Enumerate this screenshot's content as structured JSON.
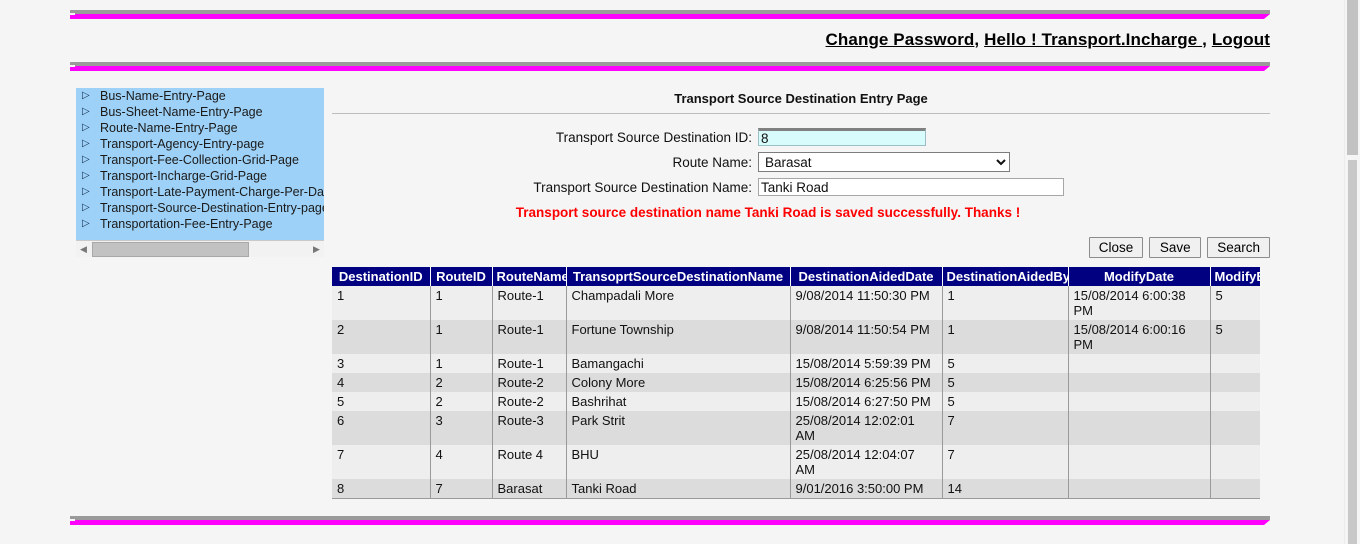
{
  "header": {
    "change_password": "Change Password",
    "separator1": ", ",
    "greeting": "Hello ! Transport.Incharge ",
    "separator2": ", ",
    "logout": "Logout"
  },
  "sidebar": {
    "items": [
      {
        "label": "Bus-Name-Entry-Page"
      },
      {
        "label": "Bus-Sheet-Name-Entry-Page"
      },
      {
        "label": "Route-Name-Entry-Page"
      },
      {
        "label": "Transport-Agency-Entry-page"
      },
      {
        "label": "Transport-Fee-Collection-Grid-Page"
      },
      {
        "label": "Transport-Incharge-Grid-Page"
      },
      {
        "label": "Transport-Late-Payment-Charge-Per-Day-Page"
      },
      {
        "label": "Transport-Source-Destination-Entry-page"
      },
      {
        "label": "Transportation-Fee-Entry-Page"
      }
    ],
    "scroll_left_arrow": "◀",
    "scroll_right_arrow": "▶"
  },
  "main": {
    "title": "Transport Source Destination Entry Page",
    "fields": {
      "id_label": "Transport Source Destination ID:",
      "id_value": "8",
      "route_label": "Route Name:",
      "route_value": "Barasat",
      "route_options": [
        "Barasat"
      ],
      "name_label": "Transport Source Destination Name:",
      "name_value": "Tanki Road",
      "name_placeholder": ""
    },
    "message": "Transport source destination name Tanki Road is saved successfully. Thanks !",
    "buttons": {
      "close": "Close",
      "save": "Save",
      "search": "Search"
    }
  },
  "grid": {
    "columns": [
      "DestinationID",
      "RouteID",
      "RouteName",
      "TransoprtSourceDestinationName",
      "DestinationAidedDate",
      "DestinationAidedBy",
      "ModifyDate",
      "ModifyBy"
    ],
    "rows": [
      [
        "1",
        "1",
        "Route-1",
        "Champadali More",
        "9/08/2014 11:50:30 PM",
        "1",
        "15/08/2014 6:00:38 PM",
        "5"
      ],
      [
        "2",
        "1",
        "Route-1",
        "Fortune Township",
        "9/08/2014 11:50:54 PM",
        "1",
        "15/08/2014 6:00:16 PM",
        "5"
      ],
      [
        "3",
        "1",
        "Route-1",
        "Bamangachi",
        "15/08/2014 5:59:39 PM",
        "5",
        "",
        ""
      ],
      [
        "4",
        "2",
        "Route-2",
        "Colony More",
        "15/08/2014 6:25:56 PM",
        "5",
        "",
        ""
      ],
      [
        "5",
        "2",
        "Route-2",
        "Bashrihat",
        "15/08/2014 6:27:50 PM",
        "5",
        "",
        ""
      ],
      [
        "6",
        "3",
        "Route-3",
        "Park Strit",
        "25/08/2014 12:02:01 AM",
        "7",
        "",
        ""
      ],
      [
        "7",
        "4",
        "Route 4",
        "BHU",
        "25/08/2014 12:04:07 AM",
        "7",
        "",
        ""
      ],
      [
        "8",
        "7",
        "Barasat",
        "Tanki Road",
        "9/01/2016 3:50:00 PM",
        "14",
        "",
        ""
      ]
    ]
  },
  "colors": {
    "rule": "#ff00ff",
    "sidebar_bg": "#9ed1f7",
    "grid_header_bg": "#000080",
    "message_text": "#fe0000"
  }
}
